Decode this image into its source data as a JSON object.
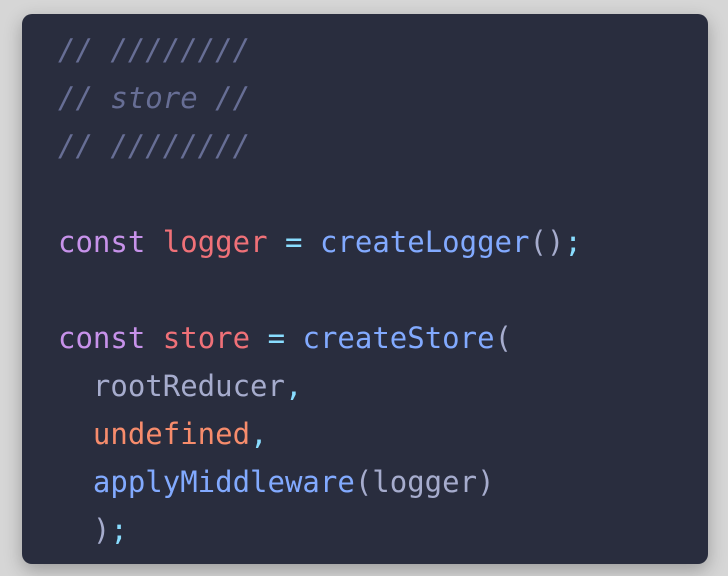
{
  "code_lines": [
    [
      {
        "t": "// ////////",
        "c": "comment"
      }
    ],
    [
      {
        "t": "// store //",
        "c": "comment"
      }
    ],
    [
      {
        "t": "// ////////",
        "c": "comment"
      }
    ],
    [],
    [
      {
        "t": "const",
        "c": "kw"
      },
      {
        "t": " ",
        "c": "ident"
      },
      {
        "t": "logger",
        "c": "var"
      },
      {
        "t": " ",
        "c": "ident"
      },
      {
        "t": "=",
        "c": "op"
      },
      {
        "t": " ",
        "c": "ident"
      },
      {
        "t": "createLogger",
        "c": "fn"
      },
      {
        "t": "()",
        "c": "paren"
      },
      {
        "t": ";",
        "c": "punc"
      }
    ],
    [],
    [
      {
        "t": "const",
        "c": "kw"
      },
      {
        "t": " ",
        "c": "ident"
      },
      {
        "t": "store",
        "c": "var"
      },
      {
        "t": " ",
        "c": "ident"
      },
      {
        "t": "=",
        "c": "op"
      },
      {
        "t": " ",
        "c": "ident"
      },
      {
        "t": "createStore",
        "c": "fn"
      },
      {
        "t": "(",
        "c": "paren"
      }
    ],
    [
      {
        "t": "  ",
        "c": "ident"
      },
      {
        "t": "rootReducer",
        "c": "ident"
      },
      {
        "t": ",",
        "c": "punc"
      }
    ],
    [
      {
        "t": "  ",
        "c": "ident"
      },
      {
        "t": "undefined",
        "c": "const"
      },
      {
        "t": ",",
        "c": "punc"
      }
    ],
    [
      {
        "t": "  ",
        "c": "ident"
      },
      {
        "t": "applyMiddleware",
        "c": "fn"
      },
      {
        "t": "(",
        "c": "paren"
      },
      {
        "t": "logger",
        "c": "ident"
      },
      {
        "t": ")",
        "c": "paren"
      }
    ],
    [
      {
        "t": "  ",
        "c": "ident"
      },
      {
        "t": ")",
        "c": "paren"
      },
      {
        "t": ";",
        "c": "punc"
      }
    ]
  ],
  "colors": {
    "background": "#292d3e",
    "comment": "#676e95",
    "keyword": "#c792ea",
    "variable": "#f07178",
    "operator": "#89ddff",
    "function": "#82aaff",
    "identifier": "#a6accd",
    "constant": "#f78c6c"
  }
}
